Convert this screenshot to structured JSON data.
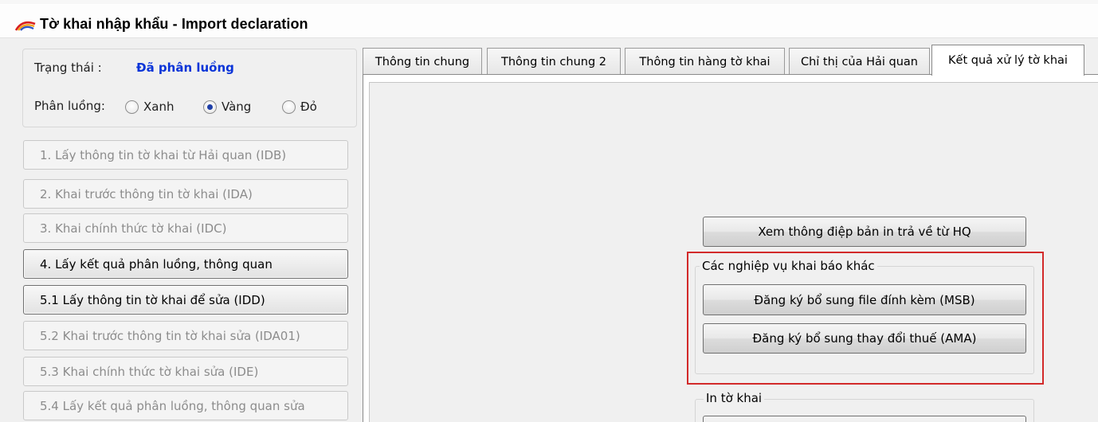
{
  "window": {
    "title": "Tờ khai nhập khẩu - Import declaration",
    "icon": "rainbow-logo-icon"
  },
  "status": {
    "label": "Trạng thái :",
    "value": "Đã phân luồng",
    "value_color": "#0a34d8",
    "route_label": "Phân luồng:",
    "options": [
      {
        "label": "Xanh",
        "selected": false
      },
      {
        "label": "Vàng",
        "selected": true
      },
      {
        "label": "Đỏ",
        "selected": false
      }
    ]
  },
  "steps": [
    {
      "label": "1. Lấy thông tin tờ khai từ Hải quan (IDB)",
      "enabled": false
    },
    {
      "label": "2. Khai trước thông tin tờ khai (IDA)",
      "enabled": false
    },
    {
      "label": "3. Khai chính thức tờ khai (IDC)",
      "enabled": false
    },
    {
      "label": "4. Lấy kết quả phân luồng, thông quan",
      "enabled": true
    },
    {
      "label": "5.1 Lấy thông tin tờ khai để sửa (IDD)",
      "enabled": true
    },
    {
      "label": "5.2 Khai trước thông tin tờ khai sửa (IDA01)",
      "enabled": false
    },
    {
      "label": "5.3 Khai chính thức tờ khai sửa (IDE)",
      "enabled": false
    },
    {
      "label": "5.4 Lấy kết quả phân luồng, thông quan sửa",
      "enabled": false
    }
  ],
  "tabs": [
    {
      "label": "Thông tin chung",
      "selected": false
    },
    {
      "label": "Thông tin chung 2",
      "selected": false
    },
    {
      "label": "Thông tin hàng tờ khai",
      "selected": false
    },
    {
      "label": "Chỉ thị của Hải quan",
      "selected": false
    },
    {
      "label": "Kết quả xử lý tờ khai",
      "selected": true
    }
  ],
  "result_tab": {
    "view_print_button": "Xem thông điệp bản in trả về từ HQ",
    "other_ops": {
      "legend": "Các nghiệp vụ khai báo khác",
      "buttons": [
        "Đăng ký bổ sung file đính kèm (MSB)",
        "Đăng ký bổ sung thay đổi thuế (AMA)"
      ]
    },
    "print": {
      "legend": "In tờ khai"
    }
  },
  "colors": {
    "highlight": "#d22a2a",
    "status_value": "#0a34d8"
  }
}
